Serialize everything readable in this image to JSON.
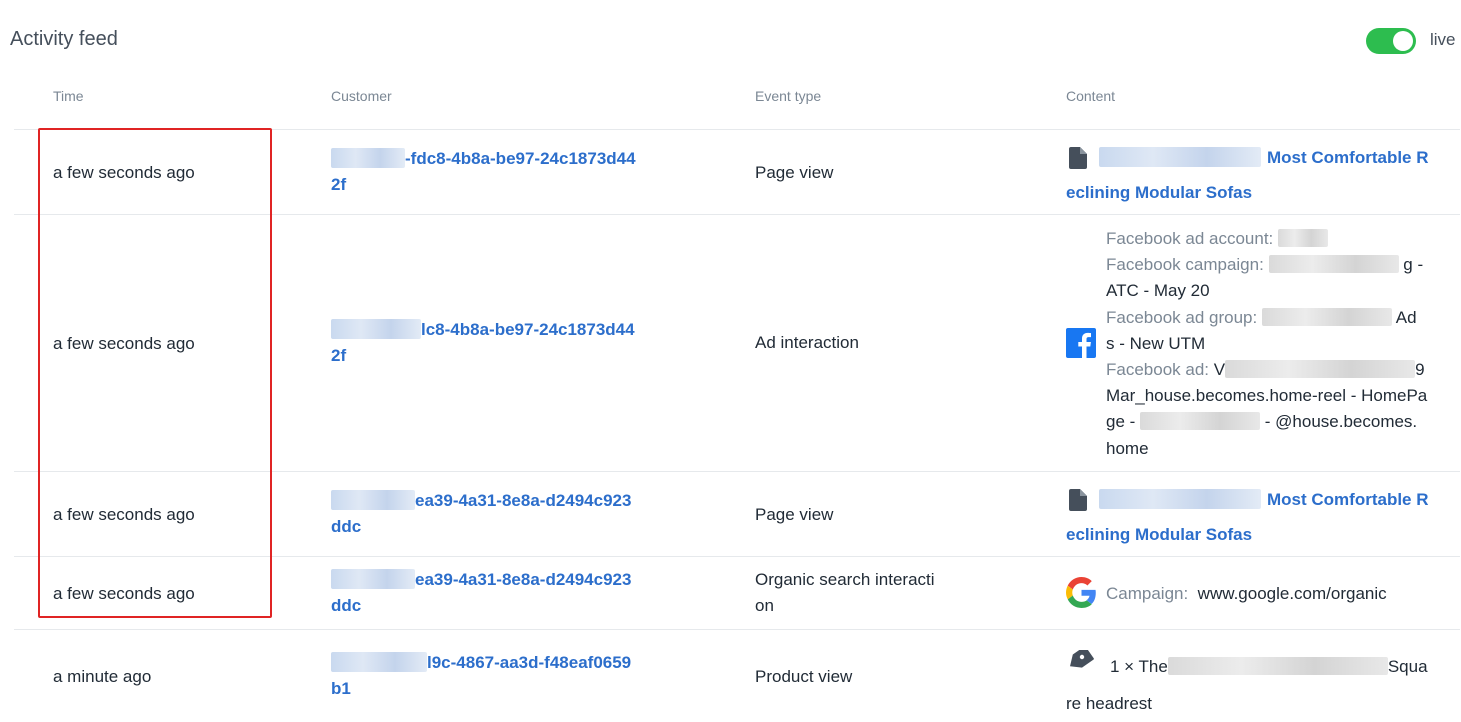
{
  "header": {
    "title": "Activity feed",
    "live_label": "live",
    "live_on": true
  },
  "columns": {
    "time": "Time",
    "customer": "Customer",
    "event_type": "Event type",
    "content": "Content"
  },
  "rows": [
    {
      "time": "a few seconds ago",
      "customer_visible": "-fdc8-4b8a-be97-24c1873d44",
      "customer_visible_2": "2f",
      "event": "Page view",
      "content_title": "Most Comfortable R",
      "content_title_2": "eclining Modular Sofas"
    },
    {
      "time": "a few seconds ago",
      "customer_visible": "lc8-4b8a-be97-24c1873d44",
      "customer_visible_2": "2f",
      "event": "Ad interaction",
      "fb": {
        "ad_account_label": "Facebook ad account:",
        "campaign_label": "Facebook campaign:",
        "campaign_tail": "g -",
        "campaign_line2": "ATC - May 20",
        "ad_group_label": "Facebook ad group:",
        "ad_group_tail": "Ad",
        "ad_group_line2": "s - New UTM",
        "ad_label": "Facebook ad:",
        "ad_head": "V",
        "ad_tail": "9",
        "ad_line2": "Mar_house.becomes.home-reel - HomePa",
        "ad_line3_head": "ge -",
        "ad_line3_tail": "- @house.becomes.",
        "ad_line4": "home"
      }
    },
    {
      "time": "a few seconds ago",
      "customer_visible": "ea39-4a31-8e8a-d2494c923",
      "customer_visible_2": "ddc",
      "event": "Page view",
      "content_title": "Most Comfortable R",
      "content_title_2": "eclining Modular Sofas"
    },
    {
      "time": "a few seconds ago",
      "customer_visible": "ea39-4a31-8e8a-d2494c923",
      "customer_visible_2": "ddc",
      "event": "Organic search interacti",
      "event_2": "on",
      "campaign_label": "Campaign:",
      "campaign_value": "www.google.com/organic"
    },
    {
      "time": "a minute ago",
      "customer_visible": "l9c-4867-aa3d-f48eaf0659",
      "customer_visible_2": "b1",
      "event": "Product view",
      "product_head": "1 × The",
      "product_tail": "Squa",
      "product_line2": "re headrest"
    }
  ],
  "colors": {
    "accent": "#2c6ecb",
    "toggle_on": "#2dbd4f",
    "highlight": "#e02424",
    "facebook": "#1877f2"
  }
}
